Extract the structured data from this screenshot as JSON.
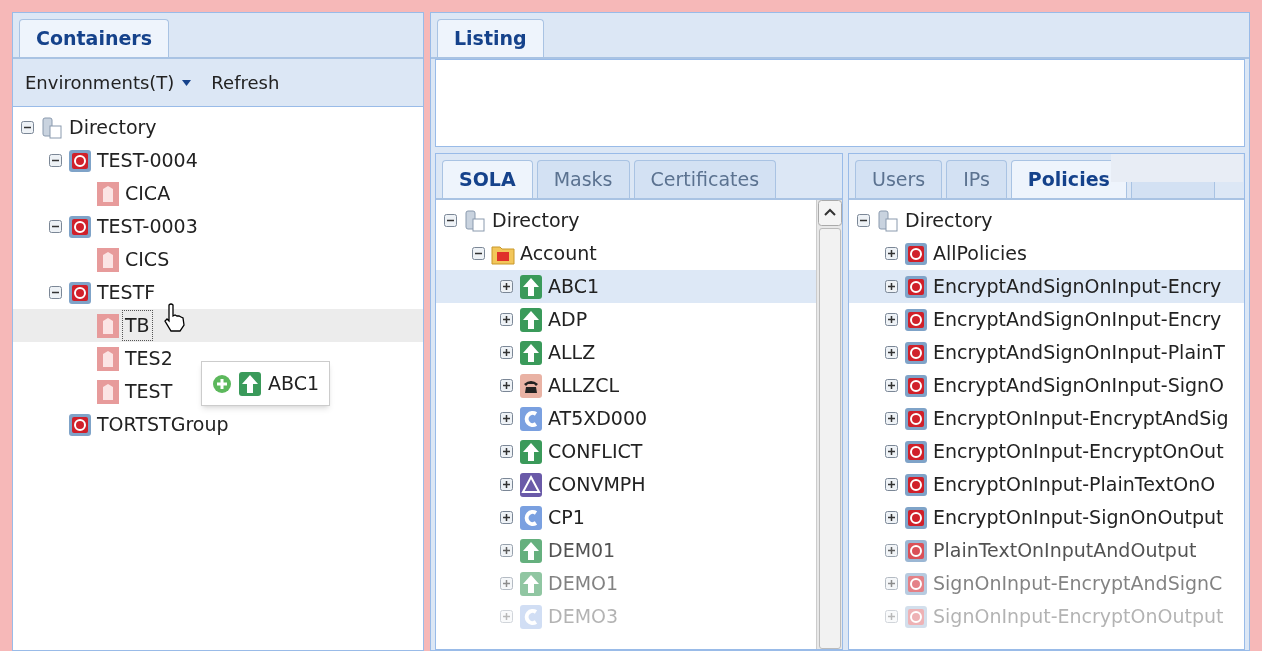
{
  "containers": {
    "tabs": [
      {
        "label": "Containers",
        "selected": true
      }
    ],
    "toolbar": {
      "dropdown": "Environments(T)",
      "refresh": "Refresh"
    },
    "tree": [
      {
        "label": "Directory",
        "kind": "directory",
        "expanded": true,
        "selected": false,
        "children": [
          {
            "label": "TEST-0004",
            "kind": "container",
            "expanded": true,
            "selected": false,
            "children": [
              {
                "label": "CICA",
                "kind": "app",
                "selected": false
              }
            ]
          },
          {
            "label": "TEST-0003",
            "kind": "container",
            "expanded": true,
            "selected": false,
            "children": [
              {
                "label": "CICS",
                "kind": "app",
                "selected": false
              }
            ]
          },
          {
            "label": "TESTF",
            "kind": "container",
            "expanded": true,
            "selected": false,
            "children": [
              {
                "label": "TB",
                "kind": "app",
                "selected": true
              },
              {
                "label": "TES2",
                "kind": "app",
                "selected": false
              },
              {
                "label": "TEST",
                "kind": "app",
                "selected": false
              }
            ]
          },
          {
            "label": "TORTSTGroup",
            "kind": "container",
            "selected": false
          }
        ]
      }
    ],
    "drag_proxy": {
      "label": "ABC1"
    }
  },
  "listing": {
    "tabs": [
      {
        "label": "Listing",
        "selected": true
      }
    ]
  },
  "sola": {
    "tabs": [
      {
        "label": "SOLA",
        "selected": true
      },
      {
        "label": "Masks",
        "selected": false
      },
      {
        "label": "Certificates",
        "selected": false
      }
    ],
    "tree": [
      {
        "label": "Directory",
        "kind": "directory",
        "expanded": true,
        "selected": false,
        "children": [
          {
            "label": "Account",
            "kind": "folder",
            "expanded": true,
            "selected": false,
            "children": [
              {
                "label": "ABC1",
                "kind": "arrow",
                "expanded": false,
                "selected": true
              },
              {
                "label": "ADP",
                "kind": "arrow",
                "expanded": false,
                "selected": false
              },
              {
                "label": "ALLZ",
                "kind": "arrow",
                "expanded": false,
                "selected": false
              },
              {
                "label": "ALLZCL",
                "kind": "phone",
                "expanded": false,
                "selected": false
              },
              {
                "label": "AT5XD000",
                "kind": "letter",
                "expanded": false,
                "selected": false
              },
              {
                "label": "CONFLICT",
                "kind": "arrow",
                "expanded": false,
                "selected": false
              },
              {
                "label": "CONVMPH",
                "kind": "triangle",
                "expanded": false,
                "selected": false
              },
              {
                "label": "CP1",
                "kind": "letter",
                "expanded": false,
                "selected": false
              },
              {
                "label": "DEM01",
                "kind": "arrow",
                "expanded": false,
                "selected": false
              },
              {
                "label": "DEMO1",
                "kind": "arrow",
                "expanded": false,
                "selected": false
              },
              {
                "label": "DEMO3",
                "kind": "letter",
                "expanded": false,
                "selected": false
              }
            ]
          }
        ]
      }
    ]
  },
  "policies": {
    "tabs": [
      {
        "label": "Users",
        "selected": false
      },
      {
        "label": "IPs",
        "selected": false
      },
      {
        "label": "Policies",
        "selected": true
      },
      {
        "selected": false
      }
    ],
    "tree": [
      {
        "label": "Directory",
        "kind": "directory",
        "expanded": true,
        "selected": false,
        "children": [
          {
            "label": "AllPolicies",
            "kind": "container",
            "expanded": false,
            "selected": false
          },
          {
            "label": "EncryptAndSignOnInput-Encry",
            "kind": "container",
            "expanded": false,
            "selected": true
          },
          {
            "label": "EncryptAndSignOnInput-Encry",
            "kind": "container",
            "expanded": false,
            "selected": false
          },
          {
            "label": "EncryptAndSignOnInput-PlainT",
            "kind": "container",
            "expanded": false,
            "selected": false
          },
          {
            "label": "EncryptAndSignOnInput-SignO",
            "kind": "container",
            "expanded": false,
            "selected": false
          },
          {
            "label": "EncryptOnInput-EncryptAndSig",
            "kind": "container",
            "expanded": false,
            "selected": false
          },
          {
            "label": "EncryptOnInput-EncryptOnOut",
            "kind": "container",
            "expanded": false,
            "selected": false
          },
          {
            "label": "EncryptOnInput-PlainTextOnO",
            "kind": "container",
            "expanded": false,
            "selected": false
          },
          {
            "label": "EncryptOnInput-SignOnOutput",
            "kind": "container",
            "expanded": false,
            "selected": false
          },
          {
            "label": "PlainTextOnInputAndOutput",
            "kind": "container",
            "expanded": false,
            "selected": false
          },
          {
            "label": "SignOnInput-EncryptAndSignC",
            "kind": "container",
            "expanded": false,
            "selected": false
          },
          {
            "label": "SignOnInput-EncryptOnOutput",
            "kind": "container",
            "expanded": false,
            "selected": false
          }
        ]
      }
    ]
  }
}
